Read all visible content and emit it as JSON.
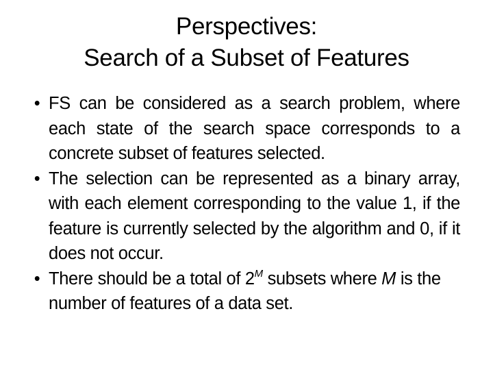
{
  "slide": {
    "title_lines": [
      "Perspectives:",
      "Search of a Subset of Features"
    ],
    "bullet_glyph": "•",
    "bullets": [
      {
        "text": "FS can be considered as a search problem, where each state of the search space corresponds to a concrete subset of features selected."
      },
      {
        "text": "The selection can be represented as a binary array, with each element corresponding to the value 1, if the feature is currently selected by the algorithm and 0, if it does not occur."
      },
      {
        "text_before": "There should be a total of 2",
        "superscript": "M",
        "text_middle": " subsets where ",
        "variable": "M",
        "text_after": " is the number of features of a data set."
      }
    ]
  }
}
